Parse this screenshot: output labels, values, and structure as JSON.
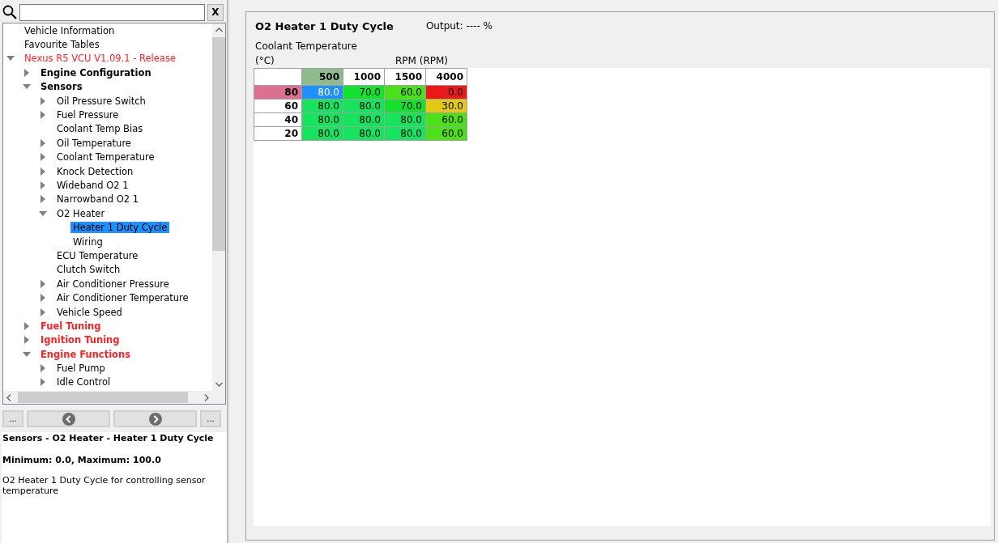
{
  "search": {
    "clear_label": "X"
  },
  "tree": [
    {
      "label": "Vehicle Information",
      "red": false,
      "bold": false,
      "collapsed": false,
      "selected": false
    },
    {
      "label": "Favourite Tables",
      "red": false,
      "bold": false,
      "collapsed": false,
      "selected": false
    },
    {
      "label": "Nexus R5 VCU V1.09.1 - Release",
      "red": true,
      "bold": false,
      "collapsed": false,
      "selected": false,
      "children": [
        {
          "label": "Engine Configuration",
          "red": false,
          "bold": true,
          "collapsed": true,
          "selected": false
        },
        {
          "label": "Sensors",
          "red": false,
          "bold": true,
          "collapsed": false,
          "selected": false,
          "children": [
            {
              "label": "Oil Pressure Switch",
              "red": false,
              "bold": false,
              "collapsed": true,
              "selected": false
            },
            {
              "label": "Fuel Pressure",
              "red": false,
              "bold": false,
              "collapsed": true,
              "selected": false
            },
            {
              "label": "Coolant Temp Bias",
              "red": false,
              "bold": false,
              "collapsed": false,
              "selected": false
            },
            {
              "label": "Oil Temperature",
              "red": false,
              "bold": false,
              "collapsed": true,
              "selected": false
            },
            {
              "label": "Coolant Temperature",
              "red": false,
              "bold": false,
              "collapsed": true,
              "selected": false
            },
            {
              "label": "Knock Detection",
              "red": false,
              "bold": false,
              "collapsed": true,
              "selected": false
            },
            {
              "label": "Wideband O2 1",
              "red": false,
              "bold": false,
              "collapsed": true,
              "selected": false
            },
            {
              "label": "Narrowband O2 1",
              "red": false,
              "bold": false,
              "collapsed": true,
              "selected": false
            },
            {
              "label": "O2 Heater",
              "red": false,
              "bold": false,
              "collapsed": false,
              "selected": false,
              "children": [
                {
                  "label": "Heater 1 Duty Cycle",
                  "red": false,
                  "bold": false,
                  "collapsed": false,
                  "selected": true
                },
                {
                  "label": "Wiring",
                  "red": false,
                  "bold": false,
                  "collapsed": false,
                  "selected": false
                }
              ]
            },
            {
              "label": "ECU Temperature",
              "red": false,
              "bold": false,
              "collapsed": false,
              "selected": false
            },
            {
              "label": "Clutch Switch",
              "red": false,
              "bold": false,
              "collapsed": false,
              "selected": false
            },
            {
              "label": "Air Conditioner Pressure",
              "red": false,
              "bold": false,
              "collapsed": true,
              "selected": false
            },
            {
              "label": "Air Conditioner Temperature",
              "red": false,
              "bold": false,
              "collapsed": true,
              "selected": false
            },
            {
              "label": "Vehicle Speed",
              "red": false,
              "bold": false,
              "collapsed": true,
              "selected": false
            }
          ]
        },
        {
          "label": "Fuel Tuning",
          "red": true,
          "bold": true,
          "collapsed": true,
          "selected": false
        },
        {
          "label": "Ignition Tuning",
          "red": true,
          "bold": true,
          "collapsed": true,
          "selected": false
        },
        {
          "label": "Engine Functions",
          "red": true,
          "bold": true,
          "collapsed": false,
          "selected": false,
          "children": [
            {
              "label": "Fuel Pump",
              "red": false,
              "bold": false,
              "collapsed": true,
              "selected": false
            },
            {
              "label": "Idle Control",
              "red": false,
              "bold": false,
              "collapsed": true,
              "selected": false
            }
          ]
        }
      ]
    }
  ],
  "nav": {
    "more_left": "...",
    "more_right": "..."
  },
  "info": {
    "path": "Sensors - O2 Heater - Heater 1 Duty Cycle",
    "range": "Minimum: 0.0, Maximum: 100.0",
    "description": "O2 Heater 1 Duty Cycle for controlling sensor temperature"
  },
  "table_view": {
    "title": "O2 Heater 1 Duty Cycle",
    "output": "Output: ---- %",
    "y_axis_name": "Coolant Temperature",
    "y_axis_unit": "(°C)",
    "x_axis": "RPM (RPM)",
    "columns": [
      {
        "label": "500",
        "selected": true
      },
      {
        "label": "1000",
        "selected": false
      },
      {
        "label": "1500",
        "selected": false
      },
      {
        "label": "4000",
        "selected": false
      }
    ],
    "rows": [
      {
        "label": "80",
        "selected": true,
        "cells": [
          {
            "value": "80.0",
            "color": "#1e90ff",
            "selected": true
          },
          {
            "value": "70.0",
            "color": "#16e02e",
            "selected": false
          },
          {
            "value": "60.0",
            "color": "#4ce01a",
            "selected": false
          },
          {
            "value": "0.0",
            "color": "#e8191a",
            "selected": false
          }
        ]
      },
      {
        "label": "60",
        "selected": false,
        "cells": [
          {
            "value": "80.0",
            "color": "#17e45e",
            "selected": false
          },
          {
            "value": "80.0",
            "color": "#17e45e",
            "selected": false
          },
          {
            "value": "70.0",
            "color": "#16e02e",
            "selected": false
          },
          {
            "value": "30.0",
            "color": "#e3c914",
            "selected": false
          }
        ]
      },
      {
        "label": "40",
        "selected": false,
        "cells": [
          {
            "value": "80.0",
            "color": "#17e45e",
            "selected": false
          },
          {
            "value": "80.0",
            "color": "#17e45e",
            "selected": false
          },
          {
            "value": "80.0",
            "color": "#17e45e",
            "selected": false
          },
          {
            "value": "60.0",
            "color": "#4ce01a",
            "selected": false
          }
        ]
      },
      {
        "label": "20",
        "selected": false,
        "cells": [
          {
            "value": "80.0",
            "color": "#17e45e",
            "selected": false
          },
          {
            "value": "80.0",
            "color": "#17e45e",
            "selected": false
          },
          {
            "value": "80.0",
            "color": "#17e45e",
            "selected": false
          },
          {
            "value": "60.0",
            "color": "#4ce01a",
            "selected": false
          }
        ]
      }
    ]
  }
}
